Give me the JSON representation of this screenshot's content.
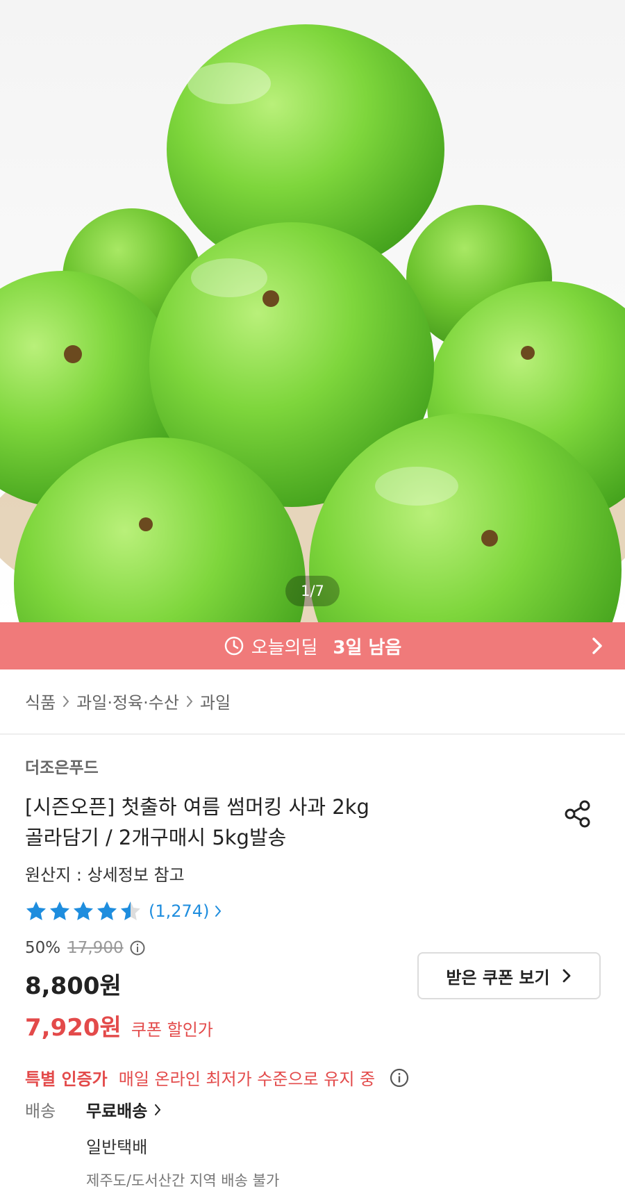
{
  "gallery": {
    "counter": "1/7",
    "alt": "green apples"
  },
  "deal": {
    "label": "오늘의딜",
    "remaining": "3일 남음"
  },
  "breadcrumb": [
    "식품",
    "과일·정육·수산",
    "과일"
  ],
  "product": {
    "seller": "더조은푸드",
    "title_line1": "[시즌오픈] 첫출하 여름 썸머킹 사과 2kg",
    "title_line2": "골라담기 / 2개구매시 5kg발송",
    "origin": "원산지 : 상세정보 참고",
    "rating_value": 4.5,
    "review_count": "(1,274)",
    "discount_rate": "50%",
    "original_price": "17,900",
    "price": "8,800원",
    "coupon_price": "7,920원",
    "coupon_price_label": "쿠폰 할인가",
    "coupon_button": "받은 쿠폰 보기",
    "special_tag": "특별 인증가",
    "special_desc": "매일 온라인 최저가 수준으로 유지 중"
  },
  "shipping": {
    "label": "배송",
    "value": "무료배송",
    "type": "일반택배",
    "note": "제주도/도서산간 지역 배송 불가"
  },
  "colors": {
    "accent_red": "#e34a4a",
    "deal_bar": "#f07a7a",
    "star_blue": "#1e8dde"
  }
}
